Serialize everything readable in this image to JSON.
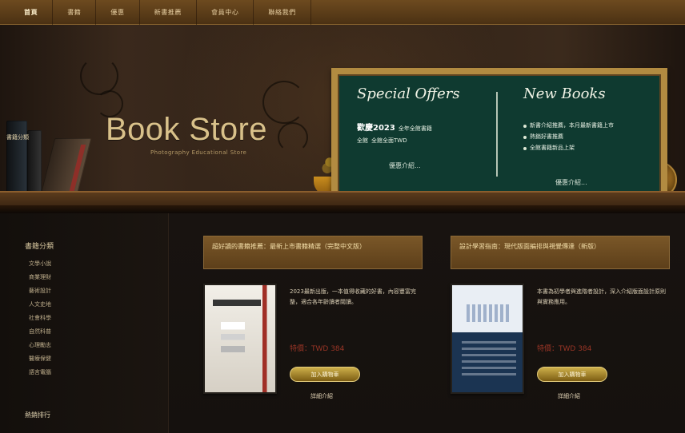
{
  "nav": {
    "items": [
      "首頁",
      "書籍",
      "優惠",
      "新書推薦",
      "會員中心",
      "聯絡我們"
    ]
  },
  "hero": {
    "title": "Book Store",
    "subtitle": "Photography Educational Store",
    "search_label": "書籍分類"
  },
  "offers": {
    "heading": "Special Offers",
    "promo_line1": "歡慶2023",
    "promo_line1_suffix": "全年全館書籍",
    "promo_line2": "全館",
    "promo_line2_suffix": "全館全面TWD",
    "link": "優惠介紹..."
  },
  "new_books": {
    "heading": "New Books",
    "items": [
      "新書介紹推薦，本月最新書籍上市",
      "熱銷好書推薦",
      "全館書籍新品上架"
    ],
    "link": "優惠介紹..."
  },
  "sidebar": {
    "title": "書籍分類",
    "items": [
      "文學小說",
      "商業理財",
      "藝術設計",
      "人文史地",
      "社會科學",
      "自然科普",
      "心理勵志",
      "醫療保健",
      "語言電腦"
    ],
    "footer": "熱銷排行"
  },
  "products": [
    {
      "title": "超好讀的書籍推薦：最新上市書籍精選（完整中文版）",
      "description": "2023最新出版，一本值得收藏的好書，內容豐富完整，適合各年齡讀者閱讀。",
      "price": "特價：TWD 384",
      "buy_label": "加入購物車",
      "details_label": "詳細介紹"
    },
    {
      "title": "設計學習指南：現代版面編排與視覺傳達（新版）",
      "description": "本書為初學者與進階者設計，深入介紹版面設計原則與實務應用。",
      "price": "特價：TWD 384",
      "buy_label": "加入購物車",
      "details_label": "詳細介紹"
    }
  ]
}
